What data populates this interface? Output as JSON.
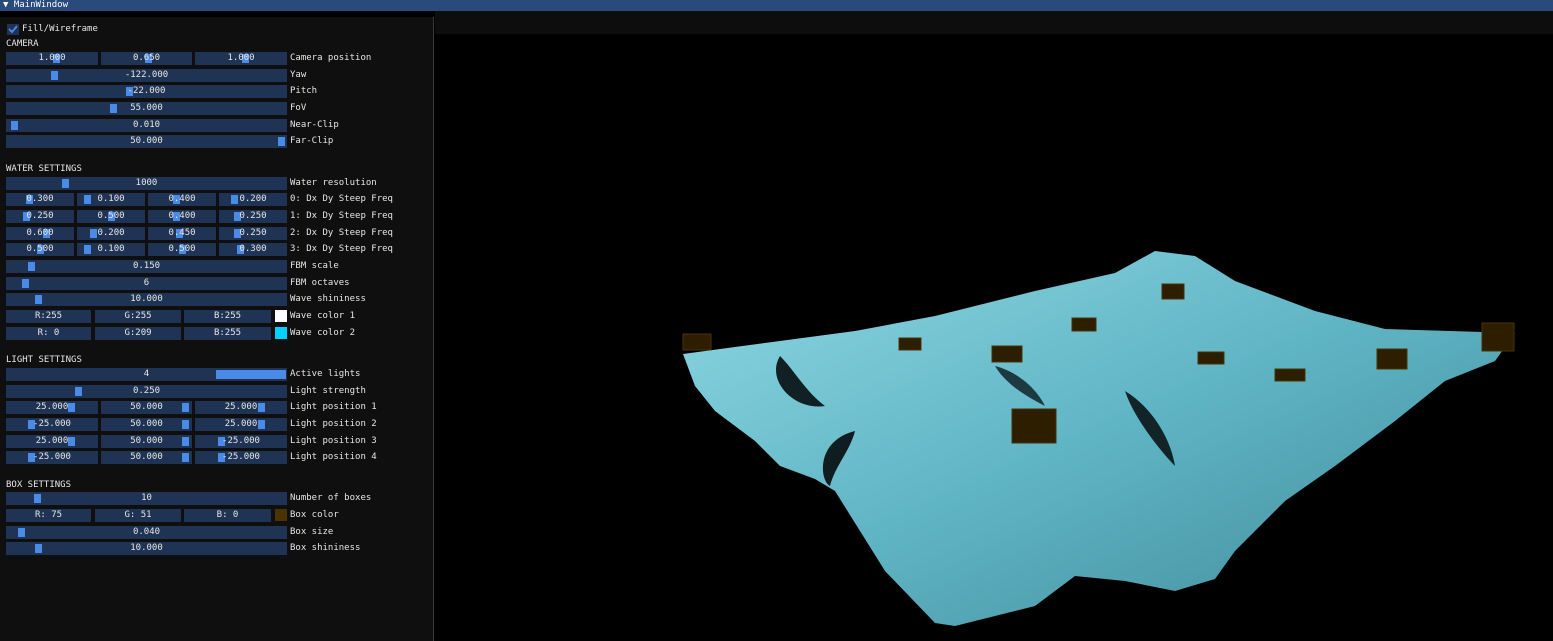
{
  "window": {
    "title": "▼ MainWindow"
  },
  "fill_wireframe": {
    "label": "Fill/Wireframe",
    "checked": true
  },
  "camera": {
    "header": "CAMERA",
    "position": {
      "label": "Camera position",
      "x": "1.000",
      "y": "0.650",
      "z": "1.000"
    },
    "yaw": {
      "label": "Yaw",
      "value": "-122.000"
    },
    "pitch": {
      "label": "Pitch",
      "value": "-22.000"
    },
    "fov": {
      "label": "FoV",
      "value": "55.000"
    },
    "near": {
      "label": "Near-Clip",
      "value": "0.010"
    },
    "far": {
      "label": "Far-Clip",
      "value": "50.000"
    }
  },
  "water": {
    "header": "WATER SETTINGS",
    "resolution": {
      "label": "Water resolution",
      "value": "1000"
    },
    "waves": [
      {
        "label": "0: Dx Dy Steep Freq",
        "v": [
          "0.300",
          "0.100",
          "0.400",
          "0.200"
        ]
      },
      {
        "label": "1: Dx Dy Steep Freq",
        "v": [
          "0.250",
          "0.500",
          "0.400",
          "0.250"
        ]
      },
      {
        "label": "2: Dx Dy Steep Freq",
        "v": [
          "0.600",
          "0.200",
          "0.450",
          "0.250"
        ]
      },
      {
        "label": "3: Dx Dy Steep Freq",
        "v": [
          "0.500",
          "0.100",
          "0.500",
          "0.300"
        ]
      }
    ],
    "fbm_scale": {
      "label": "FBM scale",
      "value": "0.150"
    },
    "fbm_octaves": {
      "label": "FBM octaves",
      "value": "6"
    },
    "shininess": {
      "label": "Wave shininess",
      "value": "10.000"
    },
    "color1": {
      "label": "Wave color 1",
      "r": "R:255",
      "g": "G:255",
      "b": "B:255",
      "hex": "#ffffff"
    },
    "color2": {
      "label": "Wave color 2",
      "r": "R:  0",
      "g": "G:209",
      "b": "B:255",
      "hex": "#00d1ff"
    }
  },
  "light": {
    "header": "LIGHT SETTINGS",
    "active": {
      "label": "Active lights",
      "value": "4"
    },
    "strength": {
      "label": "Light strength",
      "value": "0.250"
    },
    "positions": [
      {
        "label": "Light position 1",
        "v": [
          "25.000",
          "50.000",
          "25.000"
        ]
      },
      {
        "label": "Light position 2",
        "v": [
          "-25.000",
          "50.000",
          "25.000"
        ]
      },
      {
        "label": "Light position 3",
        "v": [
          "25.000",
          "50.000",
          "-25.000"
        ]
      },
      {
        "label": "Light position 4",
        "v": [
          "-25.000",
          "50.000",
          "-25.000"
        ]
      }
    ]
  },
  "box": {
    "header": "BOX SETTINGS",
    "count": {
      "label": "Number of boxes",
      "value": "10"
    },
    "color": {
      "label": "Box color",
      "r": "R: 75",
      "g": "G: 51",
      "b": "B:  0",
      "hex": "#4b3300"
    },
    "size": {
      "label": "Box size",
      "value": "0.040"
    },
    "shininess": {
      "label": "Box shininess",
      "value": "10.000"
    }
  },
  "colors": {
    "accent": "#4a8be8",
    "frame": "#1f3454",
    "title": "#294a7a",
    "water": "#7fd3de",
    "box": "#4b3300"
  }
}
